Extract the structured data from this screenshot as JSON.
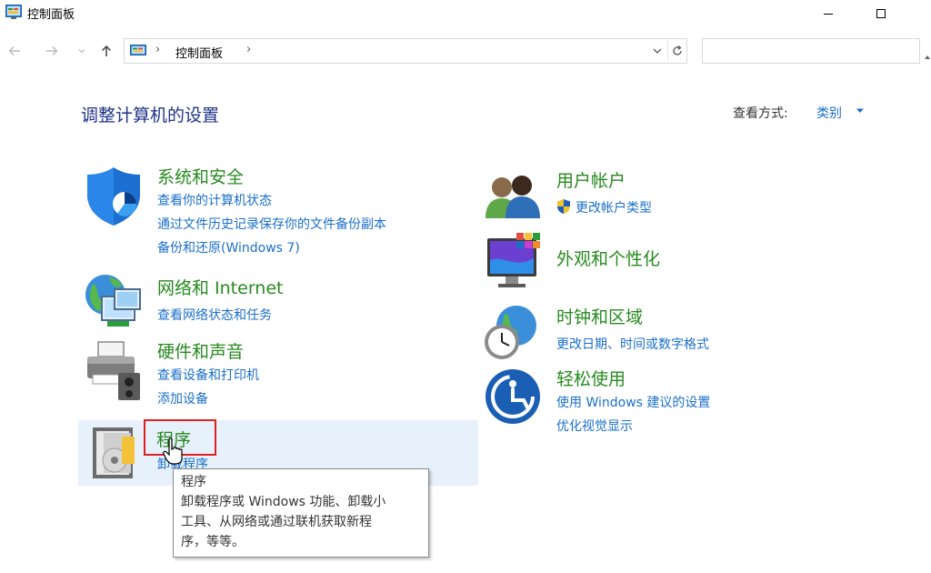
{
  "window": {
    "title": "控制面板"
  },
  "address": {
    "separator": "›",
    "crumb": "控制面板",
    "search_placeholder": ""
  },
  "header": {
    "heading": "调整计算机的设置",
    "view_by_label": "查看方式:",
    "view_by_value": "类别"
  },
  "categories": {
    "system_security": {
      "title": "系统和安全",
      "links": [
        "查看你的计算机状态",
        "通过文件历史记录保存你的文件备份副本",
        "备份和还原(Windows 7)"
      ]
    },
    "network": {
      "title": "网络和 Internet",
      "links": [
        "查看网络状态和任务"
      ]
    },
    "hardware": {
      "title": "硬件和声音",
      "links": [
        "查看设备和打印机",
        "添加设备"
      ]
    },
    "programs": {
      "title": "程序",
      "links": [
        "卸载程序"
      ]
    },
    "user_accounts": {
      "title": "用户帐户",
      "links": [
        "更改帐户类型"
      ]
    },
    "appearance": {
      "title": "外观和个性化",
      "links": []
    },
    "clock_region": {
      "title": "时钟和区域",
      "links": [
        "更改日期、时间或数字格式"
      ]
    },
    "ease_of_access": {
      "title": "轻松使用",
      "links": [
        "使用 Windows 建议的设置",
        "优化视觉显示"
      ]
    }
  },
  "tooltip": {
    "title": "程序",
    "lines": [
      "卸载程序或 Windows 功能、卸载小",
      "工具、从网络或通过联机获取新程",
      "序，等等。"
    ]
  },
  "icons": {
    "app": "control-panel-icon",
    "back": "back-arrow-icon",
    "forward": "forward-arrow-icon",
    "recent": "chevron-down-icon",
    "up": "up-arrow-icon",
    "refresh": "refresh-icon",
    "uac_shield": "uac-shield-icon"
  },
  "colors": {
    "heading": "#1e3287",
    "category_title": "#278a1f",
    "link": "#1a6fc9",
    "hover_bg": "#e6f1fb",
    "highlight_border": "#e02020"
  }
}
